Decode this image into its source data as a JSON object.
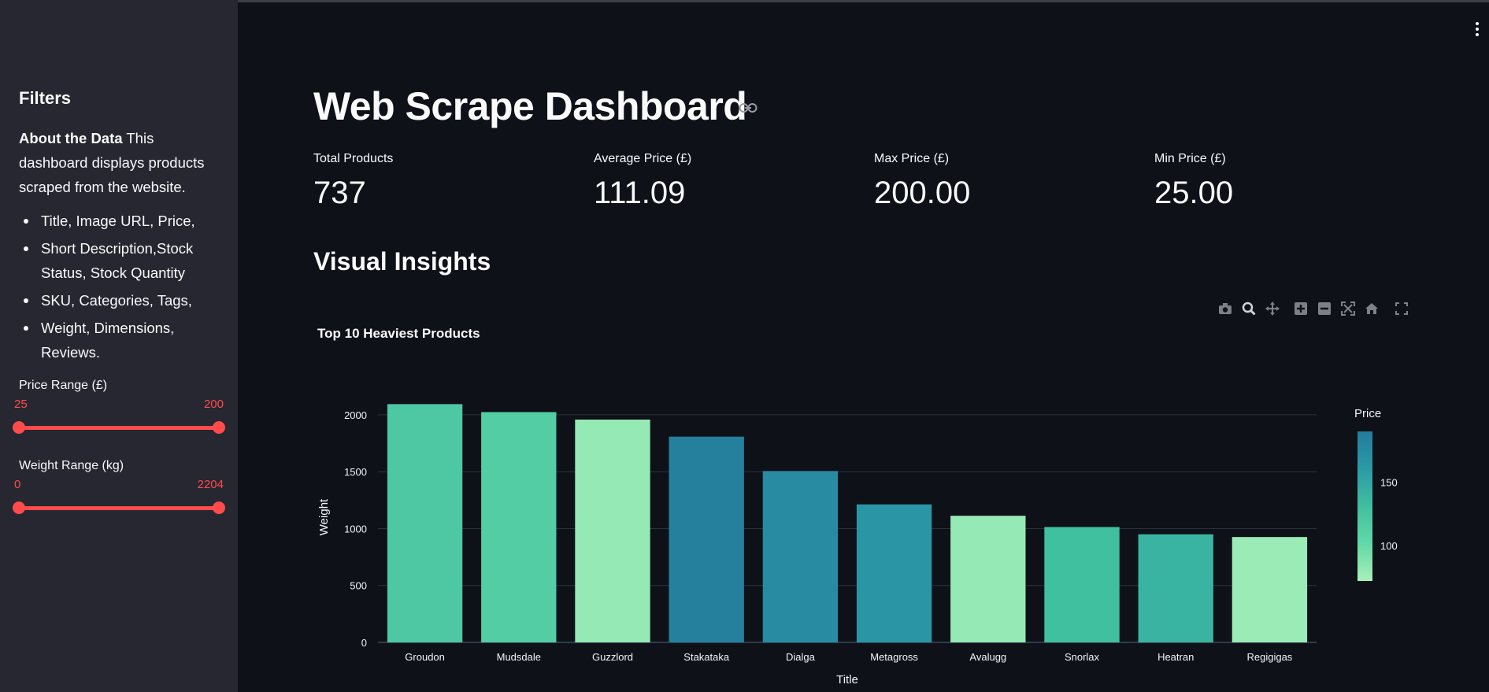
{
  "sidebar": {
    "title": "Filters",
    "about_bold": "About the Data",
    "about_text": " This dashboard displays products scraped from the website.",
    "fields": [
      "Title, Image URL, Price,",
      "Short Description,Stock Status, Stock Quantity",
      "SKU, Categories, Tags,",
      "Weight, Dimensions, Reviews."
    ],
    "price_slider": {
      "label": "Price Range (£)",
      "min": "25",
      "max": "200"
    },
    "weight_slider": {
      "label": "Weight Range (kg)",
      "min": "0",
      "max": "2204"
    }
  },
  "main": {
    "title": "Web Scrape Dashboard",
    "metrics": [
      {
        "label": "Total Products",
        "value": "737"
      },
      {
        "label": "Average Price (£)",
        "value": "111.09"
      },
      {
        "label": "Max Price (£)",
        "value": "200.00"
      },
      {
        "label": "Min Price (£)",
        "value": "25.00"
      }
    ],
    "section_title": "Visual Insights"
  },
  "toolbar_icons": [
    "camera-icon",
    "zoom-icon",
    "pan-icon",
    "zoom-in-icon",
    "zoom-out-icon",
    "autoscale-icon",
    "reset-axes-icon",
    "fullscreen-icon"
  ],
  "colors": {
    "accent": "#ff4b4b",
    "colorscale": [
      "#a8f0b8",
      "#62d8a8",
      "#40bfa0",
      "#2b9aa6",
      "#247b9c"
    ]
  },
  "chart_data": {
    "type": "bar",
    "title": "Top 10 Heaviest Products",
    "xlabel": "Title",
    "ylabel": "Weight",
    "categories": [
      "Groudon",
      "Mudsdale",
      "Guzzlord",
      "Stakataka",
      "Dialga",
      "Metagross",
      "Avalugg",
      "Snorlax",
      "Heatran",
      "Regigigas"
    ],
    "values": [
      2094,
      2024,
      1958,
      1808,
      1506,
      1213,
      1113,
      1014,
      950,
      926
    ],
    "price": [
      120,
      115,
      80,
      185,
      175,
      165,
      80,
      130,
      140,
      78
    ],
    "ylim": [
      0,
      2200
    ],
    "yticks": [
      0,
      500,
      1000,
      1500,
      2000
    ],
    "grid": true,
    "colorbar": {
      "title": "Price",
      "ticks": [
        100,
        150
      ],
      "range": [
        72,
        190
      ]
    }
  }
}
